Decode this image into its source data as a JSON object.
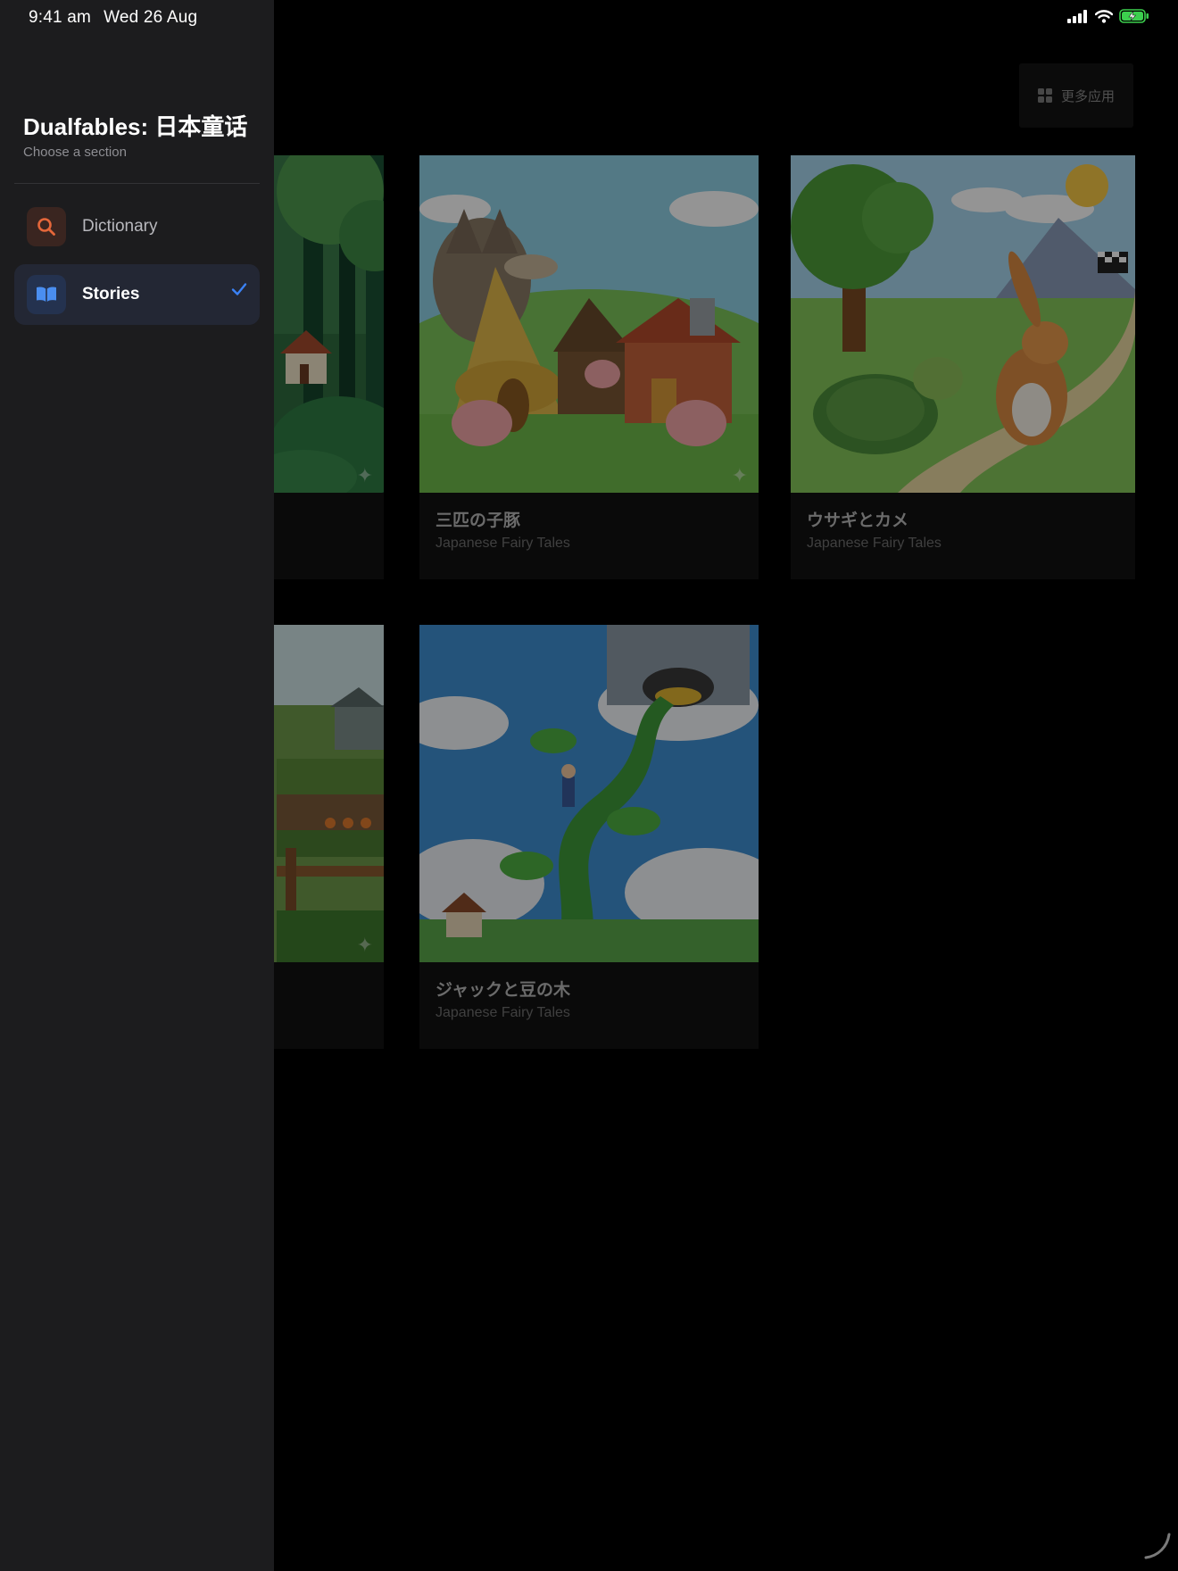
{
  "status_bar": {
    "time": "9:41 am",
    "date": "Wed 26 Aug"
  },
  "sidebar": {
    "title": "Dualfables: 日本童话",
    "subtitle": "Choose a section",
    "items": [
      {
        "label": "Dictionary",
        "icon": "search-icon",
        "selected": false
      },
      {
        "label": "Stories",
        "icon": "book-icon",
        "selected": true
      }
    ]
  },
  "header": {
    "more_apps_label": "更多应用"
  },
  "stories": [
    {
      "title": "",
      "subtitle": "",
      "image": "forest-village"
    },
    {
      "title": "三匹の子豚",
      "subtitle": "Japanese Fairy Tales",
      "image": "three-little-pigs"
    },
    {
      "title": "ウサギとカメ",
      "subtitle": "Japanese Fairy Tales",
      "image": "tortoise-and-hare"
    },
    {
      "title": "",
      "subtitle": "",
      "image": "vegetable-garden"
    },
    {
      "title": "ジャックと豆の木",
      "subtitle": "Japanese Fairy Tales",
      "image": "jack-and-beanstalk"
    }
  ],
  "colors": {
    "sidebar_bg": "#1c1c1e",
    "active_item_bg": "#232734",
    "accent_blue": "#3b82f6",
    "search_orange": "#e5673a"
  }
}
